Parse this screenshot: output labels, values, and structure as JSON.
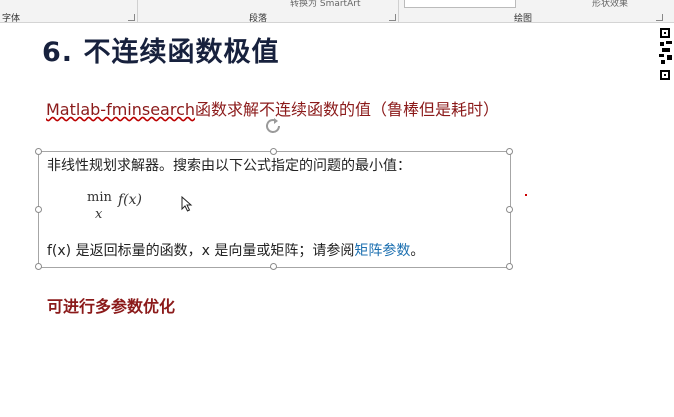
{
  "ribbon": {
    "groups": [
      {
        "label": "字体"
      },
      {
        "label": "段落"
      },
      {
        "label": "绘图"
      }
    ],
    "partial_smartart": "转换为 SmartArt",
    "partial_shape_effects": "形状效果"
  },
  "slide": {
    "title": "6. 不连续函数极值",
    "subtitle_link": "Matlab-fminsearch",
    "subtitle_rest": "函数求解不连续函数的值（鲁棒但是耗时）",
    "box": {
      "line1": "非线性规划求解器。搜索由以下公式指定的问题的最小值：",
      "formula_min": "min",
      "formula_var": "x",
      "formula_func": "f(x)",
      "line3_prefix": "f(x) 是返回标量的函数，x 是向量或矩阵；请参阅",
      "line3_link": "矩阵参数",
      "line3_suffix": "。"
    },
    "footer": "可进行多参数优化"
  },
  "colors": {
    "title": "#17213d",
    "accent_red": "#8b1a1a",
    "link_blue": "#1b6fb0"
  }
}
